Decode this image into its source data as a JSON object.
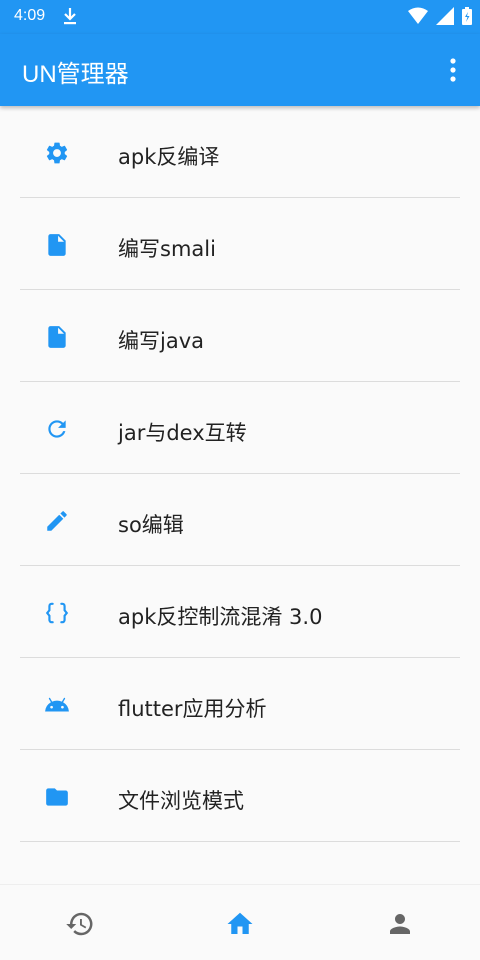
{
  "status_bar": {
    "time": "4:09"
  },
  "app_bar": {
    "title": "UN管理器"
  },
  "menu": {
    "items": [
      {
        "label": "apk反编译",
        "icon": "gear-icon"
      },
      {
        "label": "编写smali",
        "icon": "file-icon"
      },
      {
        "label": "编写java",
        "icon": "file-icon"
      },
      {
        "label": "jar与dex互转",
        "icon": "refresh-icon"
      },
      {
        "label": "so编辑",
        "icon": "pencil-icon"
      },
      {
        "label": "apk反控制流混淆 3.0",
        "icon": "braces-icon"
      },
      {
        "label": "flutter应用分析",
        "icon": "android-icon"
      },
      {
        "label": "文件浏览模式",
        "icon": "folder-icon"
      }
    ]
  },
  "bottom_nav": {
    "active": "home"
  },
  "colors": {
    "primary": "#2196f3",
    "icon_inactive": "#666666",
    "text": "#222222"
  }
}
